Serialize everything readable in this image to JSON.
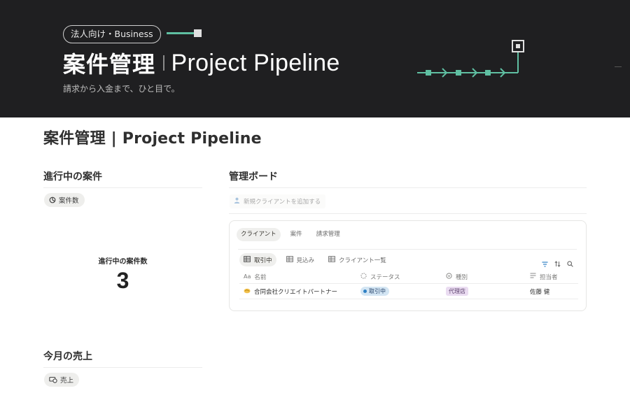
{
  "banner": {
    "tag": "法人向け・Business",
    "title_jp": "案件管理",
    "title_en": "Project Pipeline",
    "subtitle": "請求から入金まで、ひと目で。",
    "colors": {
      "background": "#1f1f21",
      "accent": "#5fbfa2"
    }
  },
  "page": {
    "title": "案件管理 | Project Pipeline"
  },
  "in_progress": {
    "heading": "進行中の案件",
    "chip_label": "案件数",
    "chip_icon": "pie-chart-icon",
    "count_label": "進行中の案件数",
    "count_value": "3"
  },
  "monthly_sales": {
    "heading": "今月の売上",
    "chip_label": "売上",
    "chip_icon": "money-icon"
  },
  "board": {
    "heading": "管理ボード",
    "add_client_label": "新規クライアントを追加する",
    "tabs": [
      {
        "label": "クライアント",
        "active": true
      },
      {
        "label": "案件",
        "active": false
      },
      {
        "label": "請求管理",
        "active": false
      }
    ],
    "views": [
      {
        "label": "取引中",
        "active": true,
        "icon": "table-icon"
      },
      {
        "label": "見込み",
        "active": false,
        "icon": "table-icon"
      },
      {
        "label": "クライアント一覧",
        "active": false,
        "icon": "table-icon"
      }
    ],
    "tools": [
      "filter-icon",
      "sort-icon",
      "search-icon"
    ],
    "columns": [
      {
        "label": "名前",
        "icon": "title-property-icon",
        "icon_text": "Aa"
      },
      {
        "label": "ステータス",
        "icon": "status-property-icon"
      },
      {
        "label": "種別",
        "icon": "select-property-icon"
      },
      {
        "label": "担当者",
        "icon": "text-property-icon"
      }
    ],
    "rows": [
      {
        "icon": "handshake-icon",
        "name": "合同会社クリエイトパートナー",
        "status": "取引中",
        "status_color": "#2f80c4",
        "type": "代理店",
        "assignee": "佐藤 健"
      }
    ]
  }
}
